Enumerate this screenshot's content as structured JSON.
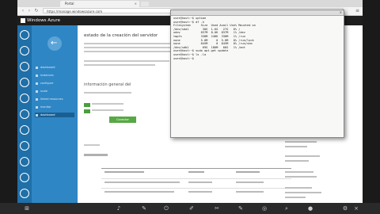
{
  "browser": {
    "tab_title": "Portal",
    "address": "https://manage.windowsazure.com"
  },
  "portal": {
    "logo_text": "Windows Azure",
    "back_label": "←",
    "sub_nav": [
      {
        "label": "dashboard"
      },
      {
        "label": "instances"
      },
      {
        "label": "configure"
      },
      {
        "label": "scale"
      },
      {
        "label": "linked resources"
      },
      {
        "label": "monitor"
      },
      {
        "label": "dashboard"
      }
    ],
    "main_title": "estado de la creación del servidor",
    "section_title": "información general del",
    "action_button": "Conectar"
  },
  "terminal": {
    "lines": [
      "user@host:~$ uptime",
      "user@host:~$ df -h",
      "Filesystem      Size  Used Avail Use% Mounted on",
      "/dev/sda1        30G  1.6G   27G   6% /",
      "udev            837M  8.0K  837M   1% /dev",
      "tmpfs           338M  248K  338M   1% /run",
      "none            5.0M     0  5.0M   0% /run/lock",
      "none            845M     0  845M   0% /run/shm",
      "/dev/sdb1        69G  180M   66G   1% /mnt",
      "user@host:~$ sudo apt-get update",
      "user@host:~$ ls -la",
      "user@host:~$ "
    ]
  },
  "colors": {
    "rail": "#1f6fa8",
    "subnav": "#2f86c4",
    "accent_green": "#58a845",
    "terminal_bg": "#f8f8f6"
  }
}
